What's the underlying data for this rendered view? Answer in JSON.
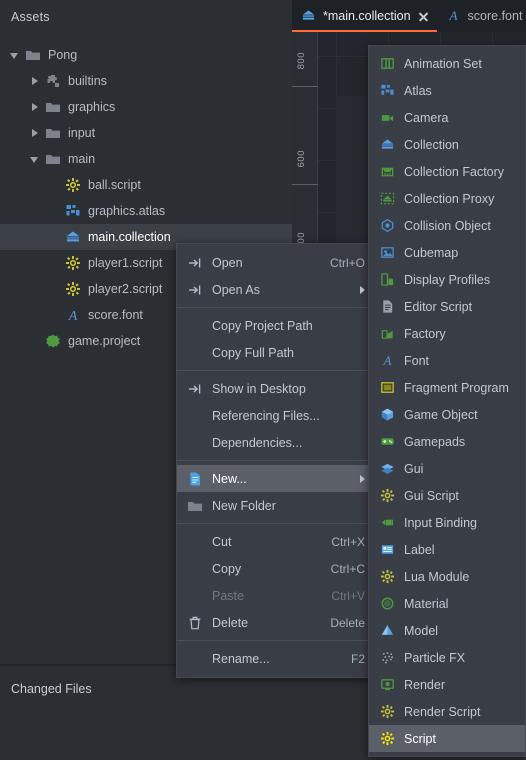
{
  "assets": {
    "title": "Assets",
    "tree": [
      {
        "label": "Pong",
        "indent": 0,
        "twisty": "open",
        "icon": "folder-icon"
      },
      {
        "label": "builtins",
        "indent": 1,
        "twisty": "closed",
        "icon": "puzzle-icon"
      },
      {
        "label": "graphics",
        "indent": 1,
        "twisty": "closed",
        "icon": "folder-icon"
      },
      {
        "label": "input",
        "indent": 1,
        "twisty": "closed",
        "icon": "folder-icon"
      },
      {
        "label": "main",
        "indent": 1,
        "twisty": "open",
        "icon": "folder-icon"
      },
      {
        "label": "ball.script",
        "indent": 2,
        "twisty": "none",
        "icon": "script-icon"
      },
      {
        "label": "graphics.atlas",
        "indent": 2,
        "twisty": "none",
        "icon": "atlas-icon"
      },
      {
        "label": "main.collection",
        "indent": 2,
        "twisty": "none",
        "icon": "collection-icon",
        "selected": true
      },
      {
        "label": "player1.script",
        "indent": 2,
        "twisty": "none",
        "icon": "script-icon"
      },
      {
        "label": "player2.script",
        "indent": 2,
        "twisty": "none",
        "icon": "script-icon"
      },
      {
        "label": "score.font",
        "indent": 2,
        "twisty": "none",
        "icon": "font-icon"
      },
      {
        "label": "game.project",
        "indent": 1,
        "twisty": "none",
        "icon": "project-icon"
      }
    ]
  },
  "changed_files": {
    "title": "Changed Files"
  },
  "editor": {
    "tabs": [
      {
        "label": "*main.collection",
        "icon": "collection-icon",
        "active": true,
        "closable": true
      },
      {
        "label": "score.font",
        "icon": "font-icon",
        "active": false,
        "closable": false
      }
    ],
    "active_tab_accent": "#ff6a3c",
    "ruler": {
      "ticks": [
        "800",
        "600",
        "00"
      ]
    }
  },
  "context_menu": {
    "items": [
      {
        "label": "Open",
        "accel": "Ctrl+O",
        "icon": "open-arrow-icon"
      },
      {
        "label": "Open As",
        "accel": "",
        "icon": "open-arrow-icon",
        "submenu": true
      },
      {
        "separator": true
      },
      {
        "label": "Copy Project Path",
        "accel": "",
        "icon": ""
      },
      {
        "label": "Copy Full Path",
        "accel": "",
        "icon": ""
      },
      {
        "separator": true
      },
      {
        "label": "Show in Desktop",
        "accel": "",
        "icon": "open-arrow-icon"
      },
      {
        "label": "Referencing Files...",
        "accel": "",
        "icon": ""
      },
      {
        "label": "Dependencies...",
        "accel": "",
        "icon": ""
      },
      {
        "separator": true
      },
      {
        "label": "New...",
        "accel": "",
        "icon": "new-file-icon",
        "submenu": true,
        "highlight": true
      },
      {
        "label": "New Folder",
        "accel": "",
        "icon": "folder-icon"
      },
      {
        "separator": true
      },
      {
        "label": "Cut",
        "accel": "Ctrl+X",
        "icon": ""
      },
      {
        "label": "Copy",
        "accel": "Ctrl+C",
        "icon": ""
      },
      {
        "label": "Paste",
        "accel": "Ctrl+V",
        "icon": "",
        "disabled": true
      },
      {
        "label": "Delete",
        "accel": "Delete",
        "icon": "trash-icon"
      },
      {
        "separator": true
      },
      {
        "label": "Rename...",
        "accel": "F2",
        "icon": ""
      }
    ]
  },
  "new_submenu": {
    "items": [
      {
        "label": "Animation Set",
        "icon": "animation-set-icon"
      },
      {
        "label": "Atlas",
        "icon": "atlas-icon"
      },
      {
        "label": "Camera",
        "icon": "camera-icon"
      },
      {
        "label": "Collection",
        "icon": "collection-icon"
      },
      {
        "label": "Collection Factory",
        "icon": "collection-factory-icon"
      },
      {
        "label": "Collection Proxy",
        "icon": "collection-proxy-icon"
      },
      {
        "label": "Collision Object",
        "icon": "collision-object-icon"
      },
      {
        "label": "Cubemap",
        "icon": "cubemap-icon"
      },
      {
        "label": "Display Profiles",
        "icon": "display-profiles-icon"
      },
      {
        "label": "Editor Script",
        "icon": "editor-script-icon"
      },
      {
        "label": "Factory",
        "icon": "factory-icon"
      },
      {
        "label": "Font",
        "icon": "font-icon"
      },
      {
        "label": "Fragment Program",
        "icon": "fragment-program-icon"
      },
      {
        "label": "Game Object",
        "icon": "game-object-icon"
      },
      {
        "label": "Gamepads",
        "icon": "gamepads-icon"
      },
      {
        "label": "Gui",
        "icon": "gui-icon"
      },
      {
        "label": "Gui Script",
        "icon": "gui-script-icon"
      },
      {
        "label": "Input Binding",
        "icon": "input-binding-icon"
      },
      {
        "label": "Label",
        "icon": "label-icon"
      },
      {
        "label": "Lua Module",
        "icon": "lua-module-icon"
      },
      {
        "label": "Material",
        "icon": "material-icon"
      },
      {
        "label": "Model",
        "icon": "model-icon"
      },
      {
        "label": "Particle FX",
        "icon": "particle-fx-icon"
      },
      {
        "label": "Render",
        "icon": "render-icon"
      },
      {
        "label": "Render Script",
        "icon": "render-script-icon"
      },
      {
        "label": "Script",
        "icon": "script-icon",
        "highlight": true
      }
    ]
  },
  "colors": {
    "accent": "#ff6a3c",
    "panel_bg": "#2b2e33",
    "menu_bg": "#393d45",
    "highlight": "#5a5f68",
    "icon_blue": "#4b8fd0",
    "icon_green": "#4f9a3f",
    "icon_yellow": "#c8c43a",
    "icon_bright_yellow": "#ffe600",
    "icon_gray": "#8b9099"
  }
}
